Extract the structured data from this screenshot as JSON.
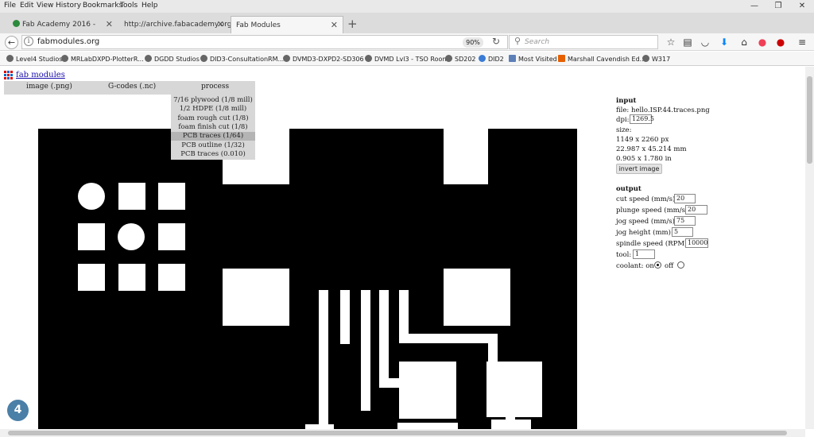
{
  "menu": [
    "File",
    "Edit",
    "View",
    "History",
    "Bookmarks",
    "Tools",
    "Help"
  ],
  "window_controls": [
    "—",
    "❐",
    "✕"
  ],
  "tabs": [
    {
      "label": "Fab Academy 2016 - Stev..."
    },
    {
      "label": "http://archive.fabacademy.org..."
    },
    {
      "label": "Fab Modules"
    }
  ],
  "new_tab": "+",
  "nav": {
    "back": "←",
    "url": "fabmodules.org",
    "zoom": "90%",
    "reload": "↻",
    "search_placeholder": "Search"
  },
  "bookmarks": [
    "Level4 Studios",
    "MRLabDXPD-PlotterR...",
    "DGDD Studios",
    "DID3-ConsultationRM...",
    "DVMD3-DXPD2-SD306",
    "DVMD Lvl3 - TSO Room",
    "SD202",
    "DID2",
    "Most Visited",
    "Marshall Cavendish Ed...",
    "W317"
  ],
  "app": {
    "title": "fab modules"
  },
  "toolbar": {
    "image": "image (.png)",
    "gcodes": "G-codes (.nc)",
    "process": "process"
  },
  "process_options": [
    "7/16 plywood (1/8 mill)",
    "1/2 HDPE (1/8 mill)",
    "foam rough cut (1/8)",
    "foam finish cut (1/8)",
    "PCB traces (1/64)",
    "PCB outline (1/32)",
    "PCB traces (0.010)"
  ],
  "process_selected_index": 4,
  "input": {
    "heading": "input",
    "file": "file: hello.ISP.44.traces.png",
    "dpi_label": "dpi:",
    "dpi": "1269.5",
    "size_label": "size:",
    "size_px": "1149 x 2260 px",
    "size_mm": "22.987 x 45.214 mm",
    "size_in": "0.905 x 1.780 in",
    "invert_button": "invert image"
  },
  "output": {
    "heading": "output",
    "cut_speed_label": "cut speed (mm/s):",
    "cut_speed": "20",
    "plunge_speed_label": "plunge speed (mm/s):",
    "plunge_speed": "20",
    "jog_speed_label": "jog speed (mm/s):",
    "jog_speed": "75",
    "jog_height_label": "jog height (mm):",
    "jog_height": "5",
    "spindle_speed_label": "spindle speed (RPM):",
    "spindle_speed": "10000",
    "tool_label": "tool:",
    "tool": "1",
    "coolant_label": "coolant: on",
    "coolant_off_label": "off",
    "coolant": "on"
  },
  "badge": "4",
  "colors": {
    "link": "#1a0dab",
    "badge": "#4a7fa7",
    "ff_orange": "#e66000",
    "pocket_red": "#ef4056",
    "download_blue": "#0a84ff"
  }
}
